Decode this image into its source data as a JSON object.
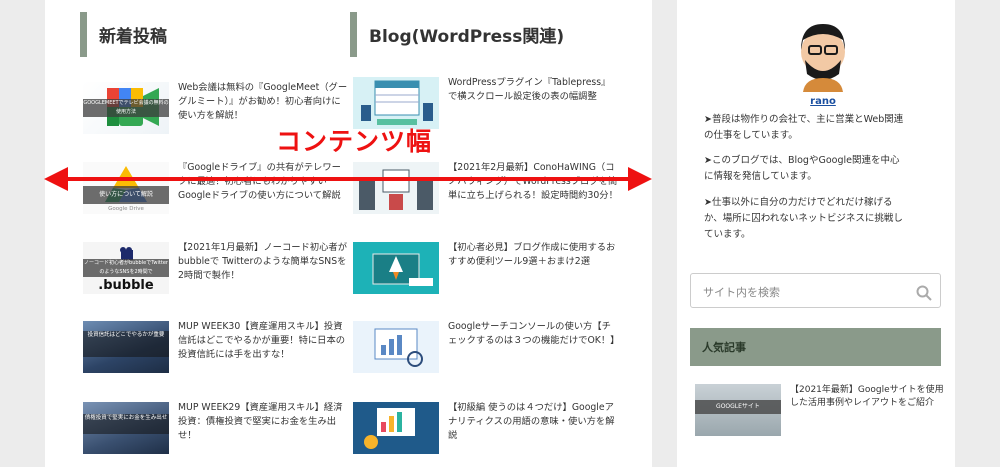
{
  "annotation": {
    "label": "コンテンツ幅"
  },
  "recent": {
    "heading": "新着投稿",
    "posts": [
      {
        "title": "Web会議は無料の『GoogleMeet（グーグルミート）』がお勧め！初心者向けに使い方を解説！",
        "thumb_text": "GOOGLEMEETでテレビ会議の無料の使用方法"
      },
      {
        "title": "『Googleドライブ』の共有がテレワークに最適！初心者にもわかりやすいGoogleドライブの使い方について解説",
        "thumb_text": "使い方について解説",
        "thumb_caption": "Google Drive"
      },
      {
        "title": "【2021年1月最新】ノーコード初心者がbubbleで Twitterのような簡単なSNSを2時間で製作！",
        "thumb_text": "ノーコード初心者がbubbleでTwitterのようなSNSを2時間で",
        "thumb_caption": ".bubble"
      },
      {
        "title": "MUP WEEK30【資産運用スキル】投資信託はどこでやるかが重要！特に日本の投資信託には手を出すな！",
        "thumb_text": "投資信託はどこでやるかが重要"
      },
      {
        "title": "MUP WEEK29【資産運用スキル】経済投資：債権投資で堅実にお金を生み出せ！",
        "thumb_text": "債権投資で堅実にお金を生み出せ"
      }
    ]
  },
  "blog": {
    "heading": "Blog(WordPress関連)",
    "posts": [
      {
        "title": "WordPressプラグイン『Tablepress』で横スクロール設定後の表の幅調整"
      },
      {
        "title": "【2021年2月最新】ConoHaWING（コノハウィング）でWordPressブログを簡単に立ち上げられる！設定時間約30分！"
      },
      {
        "title": "【初心者必見】ブログ作成に使用するおすすめ便利ツール9選＋おまけ2選"
      },
      {
        "title": "Googleサーチコンソールの使い方【チェックするのは３つの機能だけでOK！】"
      },
      {
        "title": "【初級編 使うのは４つだけ】Googleアナリティクスの用語の意味・使い方を解説"
      }
    ]
  },
  "sidebar": {
    "author": "rano",
    "bio": [
      "➤普段は物作りの会社で、主に営業とWeb関連の仕事をしています。",
      "➤このブログでは、BlogやGoogle関連を中心に情報を発信しています。",
      "➤仕事以外に自分の力だけでどれだけ稼げるか、場所に囚われないネットビジネスに挑戦しています。"
    ],
    "search_placeholder": "サイト内を検索",
    "popular_heading": "人気記事",
    "popular_post": {
      "title": "【2021年最新】Googleサイトを使用した活用事例やレイアウトをご紹介",
      "thumb_text": "GOOGLEサイト"
    }
  },
  "colors": {
    "accent": "#8a9a8a",
    "annotation": "#e11111",
    "link": "#1a4fa0"
  }
}
